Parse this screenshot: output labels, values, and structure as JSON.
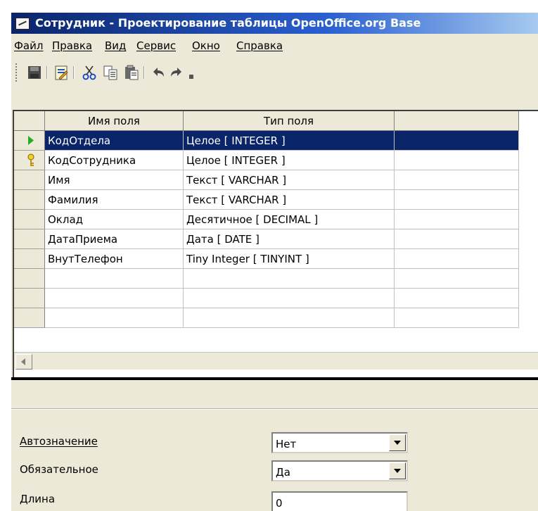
{
  "window": {
    "title": "Сотрудник - Проектирование таблицы OpenOffice.org Base"
  },
  "menu": [
    "Файл",
    "Правка",
    "Вид",
    "Сервис",
    "Окно",
    "Справка"
  ],
  "toolbar_icons": [
    "save-icon",
    "edit-icon",
    "cut-icon",
    "copy-icon",
    "paste-icon",
    "undo-icon",
    "redo-icon",
    "dropdown-icon"
  ],
  "grid": {
    "columns": [
      "Имя поля",
      "Тип поля",
      ""
    ],
    "rows": [
      {
        "name": "КодОтдела",
        "type": "Целое [ INTEGER ]",
        "marker": "current-row-arrow"
      },
      {
        "name": "КодСотрудника",
        "type": "Целое [ INTEGER ]",
        "marker": "primary-key"
      },
      {
        "name": "Имя",
        "type": "Текст [ VARCHAR ]",
        "marker": ""
      },
      {
        "name": "Фамилия",
        "type": "Текст [ VARCHAR ]",
        "marker": ""
      },
      {
        "name": "Оклад",
        "type": "Десятичное [ DECIMAL ]",
        "marker": ""
      },
      {
        "name": "ДатаПриема",
        "type": "Дата [ DATE ]",
        "marker": ""
      },
      {
        "name": "ВнутТелефон",
        "type": "Tiny Integer [ TINYINT ]",
        "marker": ""
      },
      {
        "name": "",
        "type": "",
        "marker": ""
      },
      {
        "name": "",
        "type": "",
        "marker": ""
      },
      {
        "name": "",
        "type": "",
        "marker": ""
      }
    ]
  },
  "properties": {
    "autovalue": {
      "label": "Автозначение",
      "value": "Нет"
    },
    "required": {
      "label": "Обязательное",
      "value": "Да"
    },
    "length": {
      "label": "Длина",
      "value": "0"
    }
  },
  "colors": {
    "selection": "#0a246a",
    "title_gradient_start": "#0a246a",
    "title_gradient_end": "#a6caf0",
    "window_bg": "#ece9d8"
  }
}
